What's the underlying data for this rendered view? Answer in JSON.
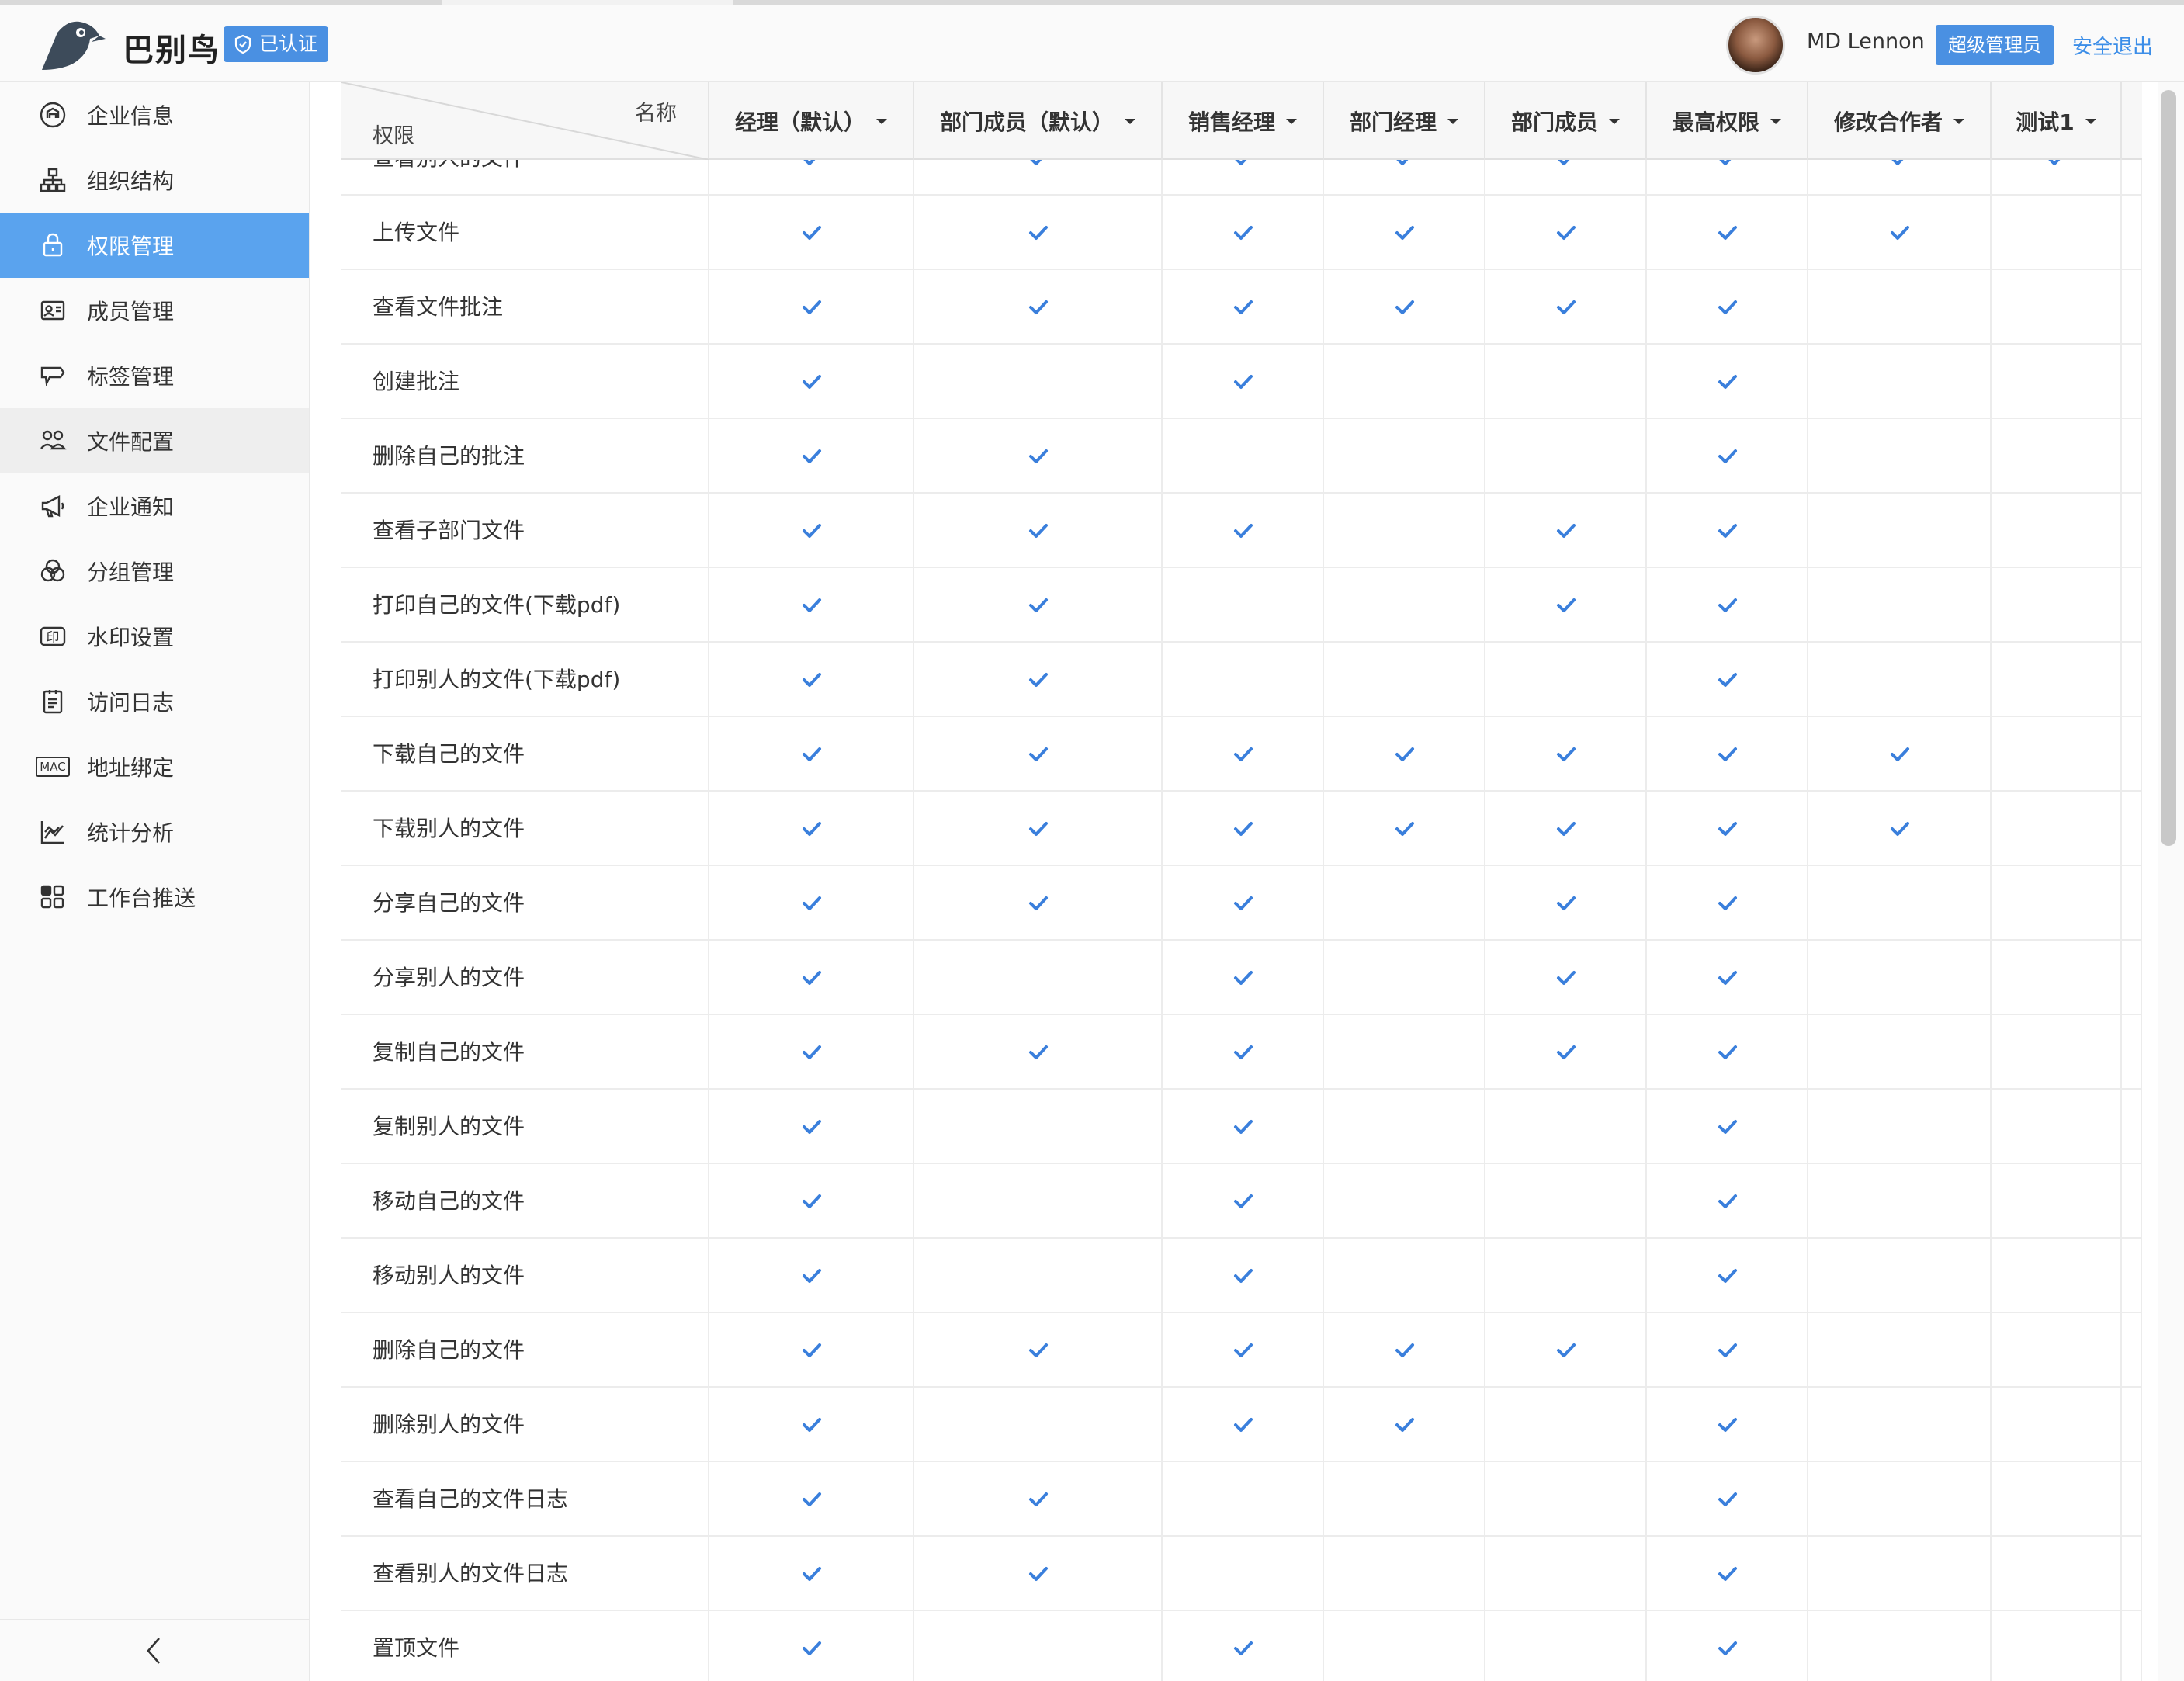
{
  "app": {
    "brand": "巴别鸟",
    "verified": "已认证",
    "user_name": "MD Lennon",
    "role": "超级管理员",
    "logout": "安全退出",
    "accent": "#4a90e2"
  },
  "sidebar": {
    "items": [
      {
        "label": "企业信息",
        "icon": "enterprise-info-icon"
      },
      {
        "label": "组织结构",
        "icon": "org-structure-icon"
      },
      {
        "label": "权限管理",
        "icon": "permission-icon",
        "active": true
      },
      {
        "label": "成员管理",
        "icon": "member-card-icon"
      },
      {
        "label": "标签管理",
        "icon": "tag-icon"
      },
      {
        "label": "文件配置",
        "icon": "file-config-icon",
        "hover": true
      },
      {
        "label": "企业通知",
        "icon": "megaphone-icon"
      },
      {
        "label": "分组管理",
        "icon": "group-circles-icon"
      },
      {
        "label": "水印设置",
        "icon": "watermark-icon",
        "glyph": "印"
      },
      {
        "label": "访问日志",
        "icon": "access-log-icon"
      },
      {
        "label": "地址绑定",
        "icon": "mac-address-icon",
        "glyph": "MAC"
      },
      {
        "label": "统计分析",
        "icon": "statistics-chart-icon"
      },
      {
        "label": "工作台推送",
        "icon": "workbench-grid-icon"
      }
    ],
    "collapse_icon": "chevron-left-icon"
  },
  "table": {
    "corner_name": "名称",
    "corner_permission": "权限",
    "columns": [
      "经理（默认）",
      "部门成员（默认）",
      "销售经理",
      "部门经理",
      "部门成员",
      "最高权限",
      "修改合作者",
      "测试1"
    ],
    "rows": [
      {
        "label": "查看别人的文件",
        "checks": [
          1,
          1,
          1,
          1,
          1,
          1,
          1,
          1
        ]
      },
      {
        "label": "上传文件",
        "checks": [
          1,
          1,
          1,
          1,
          1,
          1,
          1,
          0
        ]
      },
      {
        "label": "查看文件批注",
        "checks": [
          1,
          1,
          1,
          1,
          1,
          1,
          0,
          0
        ]
      },
      {
        "label": "创建批注",
        "checks": [
          1,
          0,
          1,
          0,
          0,
          1,
          0,
          0
        ]
      },
      {
        "label": "删除自己的批注",
        "checks": [
          1,
          1,
          0,
          0,
          0,
          1,
          0,
          0
        ]
      },
      {
        "label": "查看子部门文件",
        "checks": [
          1,
          1,
          1,
          0,
          1,
          1,
          0,
          0
        ]
      },
      {
        "label": "打印自己的文件(下载pdf)",
        "checks": [
          1,
          1,
          0,
          0,
          1,
          1,
          0,
          0
        ]
      },
      {
        "label": "打印别人的文件(下载pdf)",
        "checks": [
          1,
          1,
          0,
          0,
          0,
          1,
          0,
          0
        ]
      },
      {
        "label": "下载自己的文件",
        "checks": [
          1,
          1,
          1,
          1,
          1,
          1,
          1,
          0
        ]
      },
      {
        "label": "下载别人的文件",
        "checks": [
          1,
          1,
          1,
          1,
          1,
          1,
          1,
          0
        ]
      },
      {
        "label": "分享自己的文件",
        "checks": [
          1,
          1,
          1,
          0,
          1,
          1,
          0,
          0
        ]
      },
      {
        "label": "分享别人的文件",
        "checks": [
          1,
          0,
          1,
          0,
          1,
          1,
          0,
          0
        ]
      },
      {
        "label": "复制自己的文件",
        "checks": [
          1,
          1,
          1,
          0,
          1,
          1,
          0,
          0
        ]
      },
      {
        "label": "复制别人的文件",
        "checks": [
          1,
          0,
          1,
          0,
          0,
          1,
          0,
          0
        ]
      },
      {
        "label": "移动自己的文件",
        "checks": [
          1,
          0,
          1,
          0,
          0,
          1,
          0,
          0
        ]
      },
      {
        "label": "移动别人的文件",
        "checks": [
          1,
          0,
          1,
          0,
          0,
          1,
          0,
          0
        ]
      },
      {
        "label": "删除自己的文件",
        "checks": [
          1,
          1,
          1,
          1,
          1,
          1,
          0,
          0
        ]
      },
      {
        "label": "删除别人的文件",
        "checks": [
          1,
          0,
          1,
          1,
          0,
          1,
          0,
          0
        ]
      },
      {
        "label": "查看自己的文件日志",
        "checks": [
          1,
          1,
          0,
          0,
          0,
          1,
          0,
          0
        ]
      },
      {
        "label": "查看别人的文件日志",
        "checks": [
          1,
          1,
          0,
          0,
          0,
          1,
          0,
          0
        ]
      },
      {
        "label": "置顶文件",
        "checks": [
          1,
          0,
          1,
          0,
          0,
          1,
          0,
          0
        ]
      }
    ],
    "check_icon": "checkmark-icon",
    "check_color": "#3a7fdc"
  }
}
